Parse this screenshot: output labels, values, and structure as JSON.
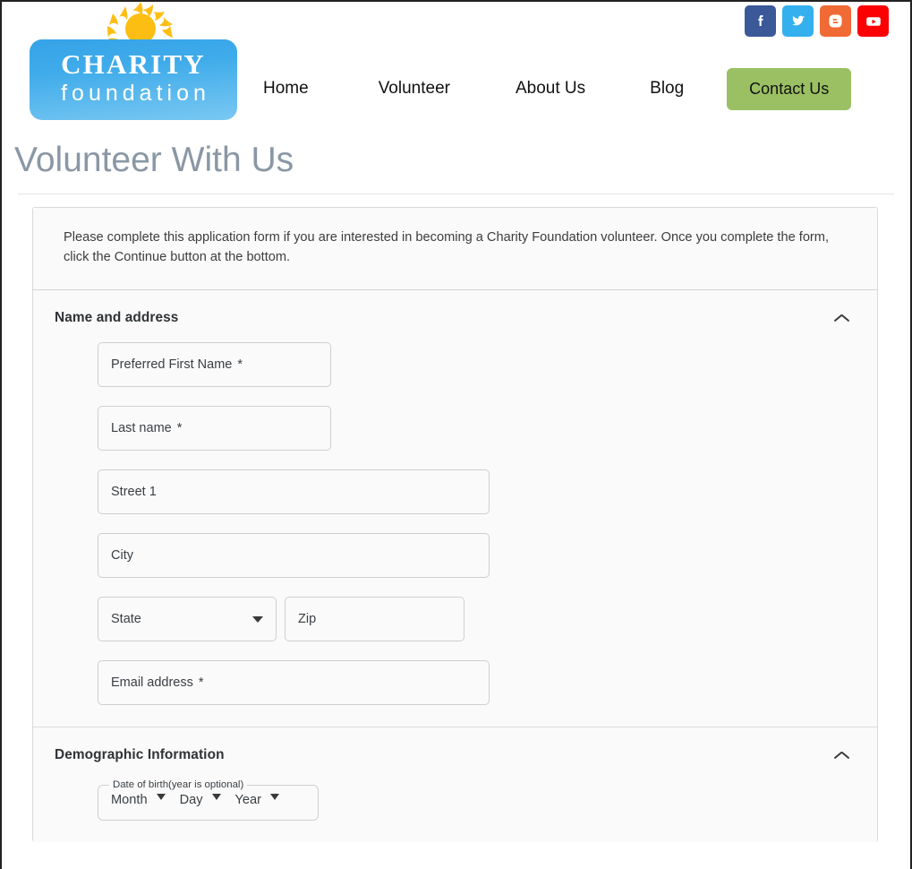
{
  "site": {
    "logo": {
      "icon": "sun-icon",
      "line1": "CHARITY",
      "line2": "foundation"
    },
    "nav": [
      {
        "id": "home",
        "label": "Home"
      },
      {
        "id": "volunteer",
        "label": "Volunteer"
      },
      {
        "id": "about",
        "label": "About Us"
      },
      {
        "id": "blog",
        "label": "Blog"
      }
    ],
    "cta": {
      "label": "Contact Us",
      "color": "#9ac063"
    },
    "social": [
      {
        "id": "facebook",
        "name": "facebook-icon",
        "color": "#3b5998"
      },
      {
        "id": "twitter",
        "name": "twitter-icon",
        "color": "#35b0ee"
      },
      {
        "id": "blogger",
        "name": "blogger-icon",
        "color": "#f06a35"
      },
      {
        "id": "youtube",
        "name": "youtube-icon",
        "color": "#fb0103"
      }
    ]
  },
  "page": {
    "title": "Volunteer With Us",
    "title_color": "#8a97a5"
  },
  "form": {
    "intro": "Please complete this application form if you are interested in becoming a Charity Foundation volunteer. Once you complete the form, click the Continue button at the bottom.",
    "sections": [
      {
        "id": "name-and-address",
        "title": "Name and address",
        "expanded": true,
        "collapse_icon": "chevron-up-icon",
        "fields": [
          {
            "id": "preferred-first-name",
            "label": "Preferred First Name",
            "required_mark": "*",
            "value": "",
            "type": "text"
          },
          {
            "id": "last-name",
            "label": "Last name",
            "required_mark": "*",
            "value": "",
            "type": "text"
          },
          {
            "id": "street-1",
            "label": "Street 1",
            "required_mark": "",
            "value": "",
            "type": "text"
          },
          {
            "id": "city",
            "label": "City",
            "required_mark": "",
            "value": "",
            "type": "text"
          },
          {
            "id": "state",
            "label": "State",
            "required_mark": "",
            "value": "",
            "type": "select"
          },
          {
            "id": "zip",
            "label": "Zip",
            "required_mark": "",
            "value": "",
            "type": "text"
          },
          {
            "id": "email-address",
            "label": "Email address",
            "required_mark": "*",
            "value": "",
            "type": "text"
          }
        ]
      },
      {
        "id": "demographic-information",
        "title": "Demographic Information",
        "expanded": true,
        "collapse_icon": "chevron-up-icon",
        "dob": {
          "legend": "Date of birth(year is optional)",
          "month": "Month",
          "day": "Day",
          "year": "Year"
        }
      }
    ]
  }
}
